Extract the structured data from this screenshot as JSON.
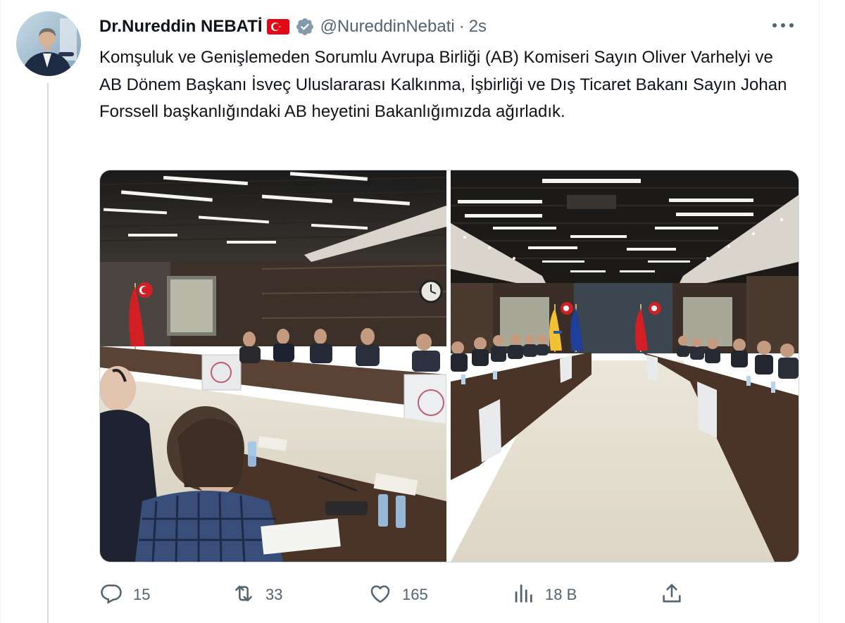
{
  "author": {
    "name": "Dr.Nureddin NEBATİ",
    "handle": "@NureddinNebati",
    "separator": "·",
    "time": "2s",
    "verified": true,
    "flag": "turkey-flag-emoji"
  },
  "tweet": {
    "text": "Komşuluk ve Genişlemeden Sorumlu Avrupa Birliği (AB) Komiseri Sayın Oliver Varhelyi ve AB Dönem Başkanı İsveç Uluslararası Kalkınma, İşbirliği ve Dış Ticaret Bakanı Sayın Johan Forssell başkanlığındaki AB heyetini Bakanlığımızda ağırladık."
  },
  "media": {
    "photos": [
      {
        "label": "meeting-photo-left"
      },
      {
        "label": "meeting-photo-right"
      }
    ]
  },
  "actions": {
    "reply_count": "15",
    "retweet_count": "33",
    "like_count": "165",
    "views_count": "18 B"
  },
  "icons": {
    "more": "more-dots-icon",
    "reply": "reply-icon",
    "retweet": "retweet-icon",
    "like": "heart-icon",
    "views": "views-chart-icon",
    "share": "share-icon"
  },
  "colors": {
    "text_primary": "#0f1419",
    "text_secondary": "#536471",
    "verified": "#829aab",
    "flag_red": "#e30a17",
    "border": "#cfd9de"
  }
}
